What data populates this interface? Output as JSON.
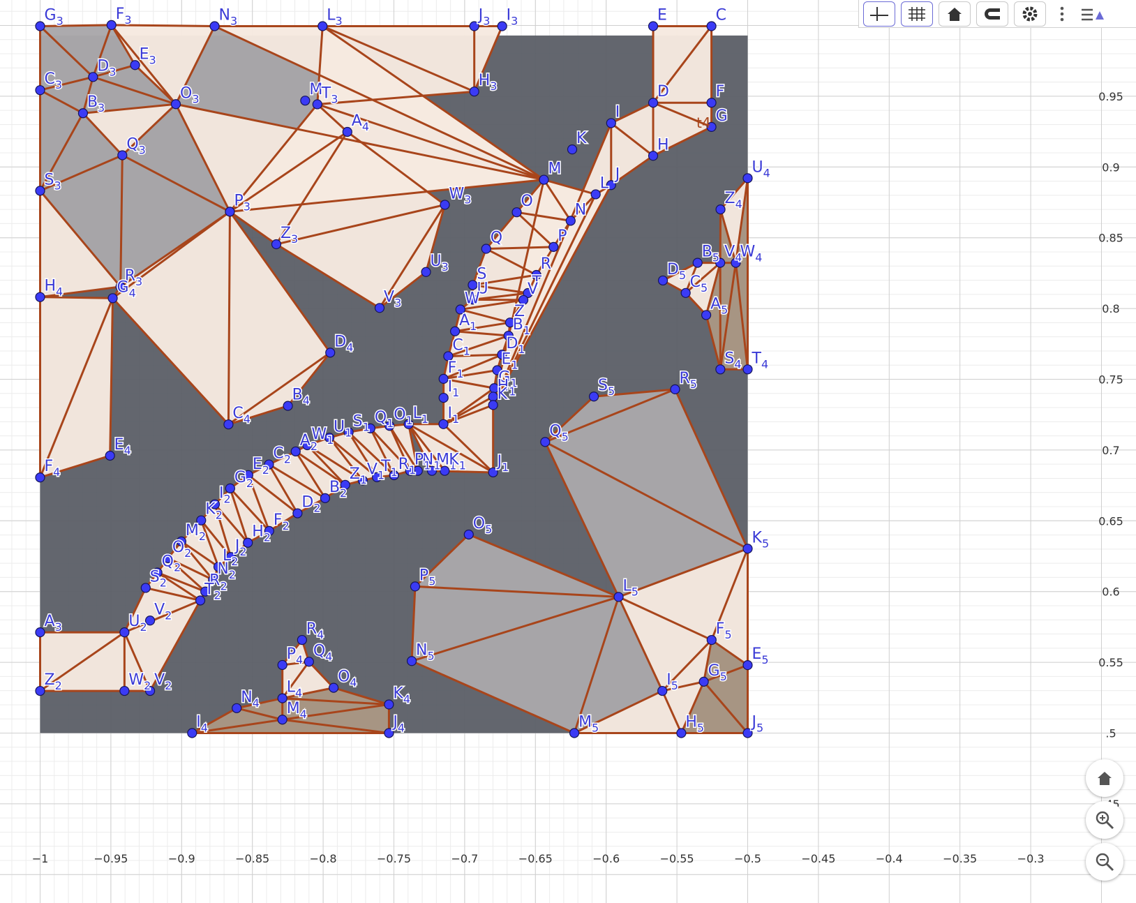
{
  "app": {
    "toolbar": {
      "buttons": [
        "axes-toggle",
        "grid-toggle",
        "home",
        "magnet",
        "settings",
        "more",
        "style-bar"
      ]
    },
    "side_buttons": [
      "home",
      "zoom-in",
      "zoom-out"
    ]
  },
  "graphics": {
    "x_ticks": [
      "−1",
      "−0.95",
      "−0.9",
      "−0.85",
      "−0.8",
      "−0.75",
      "−0.7",
      "−0.65",
      "−0.6",
      "−0.55",
      "−0.5",
      "−0.45",
      "−0.4",
      "−0.35",
      "−0.3"
    ],
    "y_ticks": [
      "0.95",
      "0.9",
      "0.85",
      "0.8",
      "0.75",
      "0.7",
      "0.65",
      "0.6",
      "0.55",
      ".5",
      ".45"
    ],
    "text_object": "t4",
    "colors": {
      "background_square": "#5b5e66",
      "light_fill": "#f6e9e0",
      "mid_fill": "#a9a7aa",
      "tan_fill": "#a99784",
      "segment": "#a8451b",
      "point": "#3b3bf5",
      "label": "#3a3ad6"
    },
    "points": [
      {
        "n": "G",
        "s": "3",
        "x": -1.0,
        "y": 0.9995
      },
      {
        "n": "F",
        "s": "3",
        "x": -0.9496,
        "y": 1.0003
      },
      {
        "n": "N",
        "s": "3",
        "x": -0.8767,
        "y": 0.9995
      },
      {
        "n": "L",
        "s": "3",
        "x": -0.8004,
        "y": 0.9995
      },
      {
        "n": "J",
        "s": "3",
        "x": -0.6932,
        "y": 0.9995
      },
      {
        "n": "I",
        "s": "3",
        "x": -0.6735,
        "y": 0.9995
      },
      {
        "n": "E",
        "s": "",
        "x": -0.5668,
        "y": 0.9995
      },
      {
        "n": "C",
        "s": "",
        "x": -0.5256,
        "y": 0.9995
      },
      {
        "n": "C",
        "s": "3",
        "x": -1.0,
        "y": 0.9543
      },
      {
        "n": "D",
        "s": "3",
        "x": -0.9626,
        "y": 0.9636
      },
      {
        "n": "E",
        "s": "3",
        "x": -0.9329,
        "y": 0.972
      },
      {
        "n": "B",
        "s": "3",
        "x": -0.9697,
        "y": 0.938
      },
      {
        "n": "O",
        "s": "3",
        "x": -0.9041,
        "y": 0.9444
      },
      {
        "n": "M",
        "s": "",
        "x": -0.8127,
        "y": 0.9469
      },
      {
        "n": "T",
        "s": "3",
        "x": -0.8041,
        "y": 0.9443
      },
      {
        "n": "H",
        "s": "3",
        "x": -0.6932,
        "y": 0.9533
      },
      {
        "n": "D",
        "s": "",
        "x": -0.5668,
        "y": 0.9454
      },
      {
        "n": "F",
        "s": "",
        "x": -0.5256,
        "y": 0.9454
      },
      {
        "n": "G",
        "s": "",
        "x": -0.5256,
        "y": 0.9283
      },
      {
        "n": "I",
        "s": "",
        "x": -0.5965,
        "y": 0.931
      },
      {
        "n": "K",
        "s": "",
        "x": -0.624,
        "y": 0.9124
      },
      {
        "n": "H",
        "s": "",
        "x": -0.5668,
        "y": 0.9079
      },
      {
        "n": "A",
        "s": "4",
        "x": -0.7829,
        "y": 0.9248
      },
      {
        "n": "Q",
        "s": "3",
        "x": -0.9419,
        "y": 0.9083
      },
      {
        "n": "S",
        "s": "3",
        "x": -1.0,
        "y": 0.8832
      },
      {
        "n": "M",
        "s": "",
        "x": -0.644,
        "y": 0.891
      },
      {
        "n": "L",
        "s": "",
        "x": -0.6074,
        "y": 0.8807
      },
      {
        "n": "J",
        "s": "",
        "x": -0.5965,
        "y": 0.8872
      },
      {
        "n": "U",
        "s": "4",
        "x": -0.5,
        "y": 0.8921
      },
      {
        "n": "W",
        "s": "3",
        "x": -0.714,
        "y": 0.8733
      },
      {
        "n": "P",
        "s": "3",
        "x": -0.8659,
        "y": 0.8684
      },
      {
        "n": "O",
        "s": "",
        "x": -0.6632,
        "y": 0.868
      },
      {
        "n": "N",
        "s": "",
        "x": -0.6251,
        "y": 0.862
      },
      {
        "n": "Z",
        "s": "4",
        "x": -0.5192,
        "y": 0.87
      },
      {
        "n": "Z",
        "s": "3",
        "x": -0.8331,
        "y": 0.8454
      },
      {
        "n": "Q",
        "s": "",
        "x": -0.6848,
        "y": 0.8422
      },
      {
        "n": "P",
        "s": "",
        "x": -0.6372,
        "y": 0.8435
      },
      {
        "n": "B",
        "s": "5",
        "x": -0.5354,
        "y": 0.8323
      },
      {
        "n": "V",
        "s": "4",
        "x": -0.5194,
        "y": 0.8323
      },
      {
        "n": "W",
        "s": "4",
        "x": -0.5084,
        "y": 0.8323
      },
      {
        "n": "D",
        "s": "5",
        "x": -0.5599,
        "y": 0.8198
      },
      {
        "n": "C",
        "s": "5",
        "x": -0.5438,
        "y": 0.811
      },
      {
        "n": "A",
        "s": "5",
        "x": -0.5293,
        "y": 0.7954
      },
      {
        "n": "U",
        "s": "3",
        "x": -0.7273,
        "y": 0.8258
      },
      {
        "n": "R",
        "s": "3",
        "x": -0.9432,
        "y": 0.8154
      },
      {
        "n": "G",
        "s": "4",
        "x": -0.9487,
        "y": 0.8073
      },
      {
        "n": "H",
        "s": "4",
        "x": -1.0,
        "y": 0.8081
      },
      {
        "n": "S",
        "s": "",
        "x": -0.6943,
        "y": 0.8166
      },
      {
        "n": "R",
        "s": "",
        "x": -0.6493,
        "y": 0.8237
      },
      {
        "n": "T",
        "s": "",
        "x": -0.6553,
        "y": 0.8109
      },
      {
        "n": "U",
        "s": "",
        "x": -0.6943,
        "y": 0.8063
      },
      {
        "n": "V",
        "s": "",
        "x": -0.6585,
        "y": 0.806
      },
      {
        "n": "W",
        "s": "",
        "x": -0.703,
        "y": 0.7993
      },
      {
        "n": "Z",
        "s": "",
        "x": -0.6679,
        "y": 0.7901
      },
      {
        "n": "V",
        "s": "3",
        "x": -0.7601,
        "y": 0.8004
      },
      {
        "n": "A",
        "s": "1",
        "x": -0.7068,
        "y": 0.7839
      },
      {
        "n": "B",
        "s": "1",
        "x": -0.669,
        "y": 0.7808
      },
      {
        "n": "D",
        "s": "4",
        "x": -0.795,
        "y": 0.7688
      },
      {
        "n": "D",
        "s": "1",
        "x": -0.6736,
        "y": 0.7674
      },
      {
        "n": "C",
        "s": "1",
        "x": -0.7116,
        "y": 0.7663
      },
      {
        "n": "S",
        "s": "4",
        "x": -0.5193,
        "y": 0.757
      },
      {
        "n": "T",
        "s": "4",
        "x": -0.5,
        "y": 0.757
      },
      {
        "n": "E",
        "s": "1",
        "x": -0.677,
        "y": 0.7564
      },
      {
        "n": "F",
        "s": "1",
        "x": -0.7149,
        "y": 0.7503
      },
      {
        "n": "R",
        "s": "5",
        "x": -0.5513,
        "y": 0.7429
      },
      {
        "n": "G",
        "s": "1",
        "x": -0.6791,
        "y": 0.7437
      },
      {
        "n": "H",
        "s": "1",
        "x": -0.6799,
        "y": 0.7377
      },
      {
        "n": "S",
        "s": "5",
        "x": -0.6087,
        "y": 0.7378
      },
      {
        "n": "I",
        "s": "1",
        "x": -0.7149,
        "y": 0.7369
      },
      {
        "n": "B",
        "s": "4",
        "x": -0.8249,
        "y": 0.7312
      },
      {
        "n": "K",
        "s": "",
        "x": -0.6799,
        "y": 0.7318
      },
      {
        "n": "C",
        "s": "4",
        "x": -0.8669,
        "y": 0.7181
      },
      {
        "n": "L",
        "s": "1",
        "x": -0.7396,
        "y": 0.7183
      },
      {
        "n": "I",
        "s": "1",
        "x": -0.715,
        "y": 0.7183
      },
      {
        "n": "O",
        "s": "1",
        "x": -0.7531,
        "y": 0.7171
      },
      {
        "n": "Q",
        "s": "1",
        "x": -0.7666,
        "y": 0.7153
      },
      {
        "n": "S",
        "s": "1",
        "x": -0.782,
        "y": 0.7126
      },
      {
        "n": "U",
        "s": "1",
        "x": -0.7956,
        "y": 0.7087
      },
      {
        "n": "Q",
        "s": "5",
        "x": -0.6431,
        "y": 0.7057
      },
      {
        "n": "W",
        "s": "1",
        "x": -0.8112,
        "y": 0.7034
      },
      {
        "n": "A",
        "s": "2",
        "x": -0.8194,
        "y": 0.699
      },
      {
        "n": "E",
        "s": "4",
        "x": -0.9506,
        "y": 0.696
      },
      {
        "n": "J",
        "s": "1",
        "x": -0.6799,
        "y": 0.6842
      },
      {
        "n": "M",
        "s": "1",
        "x": -0.7231,
        "y": 0.6853
      },
      {
        "n": "K",
        "s": "1",
        "x": -0.7141,
        "y": 0.6853
      },
      {
        "n": "N",
        "s": "1",
        "x": -0.7331,
        "y": 0.6853
      },
      {
        "n": "P",
        "s": "1",
        "x": -0.7385,
        "y": 0.6853
      },
      {
        "n": "R",
        "s": "1",
        "x": -0.7499,
        "y": 0.6822
      },
      {
        "n": "T",
        "s": "1",
        "x": -0.762,
        "y": 0.6808
      },
      {
        "n": "V",
        "s": "1",
        "x": -0.772,
        "y": 0.6785
      },
      {
        "n": "Z",
        "s": "1",
        "x": -0.7844,
        "y": 0.6754
      },
      {
        "n": "C",
        "s": "2",
        "x": -0.8383,
        "y": 0.6898
      },
      {
        "n": "F",
        "s": "4",
        "x": -1.0,
        "y": 0.6806
      },
      {
        "n": "E",
        "s": "2",
        "x": -0.8529,
        "y": 0.6823
      },
      {
        "n": "B",
        "s": "2",
        "x": -0.7986,
        "y": 0.666
      },
      {
        "n": "G",
        "s": "2",
        "x": -0.8657,
        "y": 0.6729
      },
      {
        "n": "D",
        "s": "2",
        "x": -0.8181,
        "y": 0.6553
      },
      {
        "n": "I",
        "s": "2",
        "x": -0.8765,
        "y": 0.6617
      },
      {
        "n": "K",
        "s": "2",
        "x": -0.8862,
        "y": 0.6503
      },
      {
        "n": "F",
        "s": "2",
        "x": -0.8381,
        "y": 0.6428
      },
      {
        "n": "H",
        "s": "2",
        "x": -0.8532,
        "y": 0.6345
      },
      {
        "n": "M",
        "s": "2",
        "x": -0.9002,
        "y": 0.6354
      },
      {
        "n": "O",
        "s": "5",
        "x": -0.6971,
        "y": 0.6403
      },
      {
        "n": "J",
        "s": "2",
        "x": -0.8652,
        "y": 0.6244
      },
      {
        "n": "O",
        "s": "2",
        "x": -0.9096,
        "y": 0.6236
      },
      {
        "n": "K",
        "s": "5",
        "x": -0.5,
        "y": 0.6303
      },
      {
        "n": "L",
        "s": "2",
        "x": -0.874,
        "y": 0.6175
      },
      {
        "n": "Q",
        "s": "2",
        "x": -0.9171,
        "y": 0.6134
      },
      {
        "n": "N",
        "s": "2",
        "x": -0.8778,
        "y": 0.6083
      },
      {
        "n": "S",
        "s": "2",
        "x": -0.9254,
        "y": 0.6026
      },
      {
        "n": "P",
        "s": "5",
        "x": -0.735,
        "y": 0.6036
      },
      {
        "n": "R",
        "s": "2",
        "x": -0.8833,
        "y": 0.6
      },
      {
        "n": "L",
        "s": "5",
        "x": -0.5912,
        "y": 0.5962
      },
      {
        "n": "T",
        "s": "2",
        "x": -0.8868,
        "y": 0.5937
      },
      {
        "n": "U",
        "s": "2",
        "x": -0.9404,
        "y": 0.5712
      },
      {
        "n": "A",
        "s": "3",
        "x": -1.0,
        "y": 0.5712
      },
      {
        "n": "V",
        "s": "2",
        "x": -0.9223,
        "y": 0.5795
      },
      {
        "n": "F",
        "s": "5",
        "x": -0.5255,
        "y": 0.5658
      },
      {
        "n": "R",
        "s": "4",
        "x": -0.8149,
        "y": 0.5658
      },
      {
        "n": "P",
        "s": "4",
        "x": -0.8288,
        "y": 0.5481
      },
      {
        "n": "Q",
        "s": "4",
        "x": -0.81,
        "y": 0.5504
      },
      {
        "n": "N",
        "s": "5",
        "x": -0.7374,
        "y": 0.5509
      },
      {
        "n": "E",
        "s": "5",
        "x": -0.5,
        "y": 0.548
      },
      {
        "n": "G",
        "s": "5",
        "x": -0.531,
        "y": 0.5363
      },
      {
        "n": "O",
        "s": "4",
        "x": -0.7926,
        "y": 0.532
      },
      {
        "n": "I",
        "s": "5",
        "x": -0.5603,
        "y": 0.5298
      },
      {
        "n": "Z",
        "s": "2",
        "x": -1.0,
        "y": 0.5298
      },
      {
        "n": "W",
        "s": "2",
        "x": -0.9404,
        "y": 0.5298
      },
      {
        "n": "V",
        "s": "2",
        "x": -0.9223,
        "y": 0.5298
      },
      {
        "n": "L",
        "s": "4",
        "x": -0.8288,
        "y": 0.5246
      },
      {
        "n": "N",
        "s": "4",
        "x": -0.8611,
        "y": 0.5176
      },
      {
        "n": "K",
        "s": "4",
        "x": -0.7535,
        "y": 0.5202
      },
      {
        "n": "M",
        "s": "4",
        "x": -0.8288,
        "y": 0.5095
      },
      {
        "n": "M",
        "s": "5",
        "x": -0.6225,
        "y": 0.5
      },
      {
        "n": "H",
        "s": "5",
        "x": -0.5469,
        "y": 0.5
      },
      {
        "n": "J",
        "s": "5",
        "x": -0.5,
        "y": 0.5
      },
      {
        "n": "I",
        "s": "4",
        "x": -0.8926,
        "y": 0.5
      },
      {
        "n": "J",
        "s": "4",
        "x": -0.7535,
        "y": 0.5
      }
    ]
  }
}
